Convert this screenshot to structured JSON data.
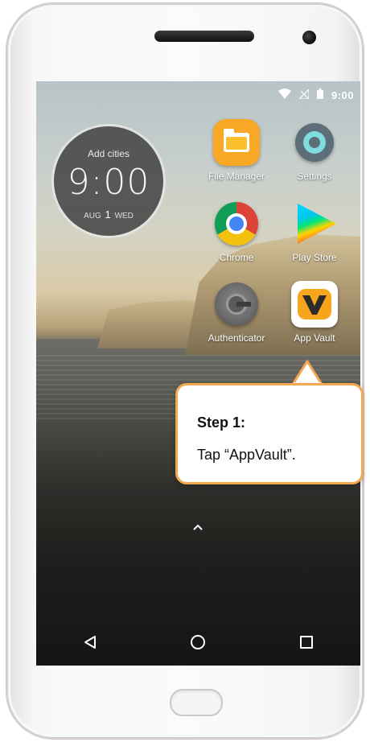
{
  "status_bar": {
    "time": "9:00"
  },
  "clock_widget": {
    "cities": "Add cities",
    "time": "9:00",
    "date_month": "AUG",
    "date_day": "1",
    "date_weekday": "WED"
  },
  "apps": [
    {
      "label": "File Manager",
      "icon": "file-manager-icon"
    },
    {
      "label": "Settings",
      "icon": "settings-icon"
    },
    {
      "label": "Chrome",
      "icon": "chrome-icon"
    },
    {
      "label": "Play Store",
      "icon": "play-store-icon"
    },
    {
      "label": "Authenticator",
      "icon": "authenticator-icon"
    },
    {
      "label": "App Vault",
      "icon": "app-vault-icon"
    }
  ],
  "app_drawer": {
    "arrow": "^"
  },
  "callout": {
    "step": "Step 1:",
    "text": "Tap “AppVault”.",
    "border_color": "#f3a850"
  }
}
